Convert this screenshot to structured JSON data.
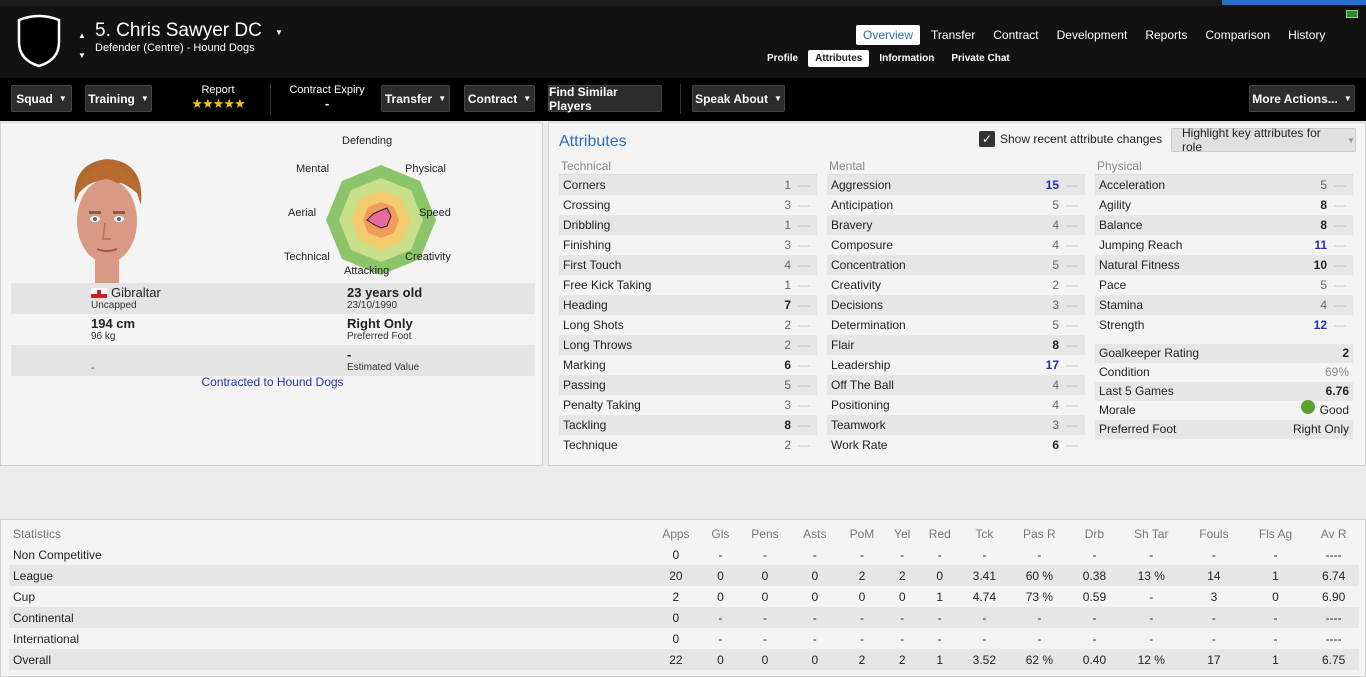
{
  "header": {
    "player_name": "5. Chris Sawyer DC",
    "subtitle": "Defender (Centre) - Hound Dogs",
    "main_tabs": [
      "Overview",
      "Transfer",
      "Contract",
      "Development",
      "Reports",
      "Comparison",
      "History"
    ],
    "active_main_tab": "Overview",
    "sub_tabs": [
      "Profile",
      "Attributes",
      "Information",
      "Private Chat"
    ],
    "active_sub_tab": "Attributes"
  },
  "toolbar": {
    "squad": "Squad",
    "training": "Training",
    "report_label": "Report",
    "report_stars": "★★★★★",
    "contract_expiry_label": "Contract Expiry",
    "contract_expiry_value": "-",
    "transfer": "Transfer",
    "contract": "Contract",
    "find_similar": "Find Similar Players",
    "speak_about": "Speak About",
    "more_actions": "More Actions..."
  },
  "profile": {
    "radar_labels": {
      "defending": "Defending",
      "physical": "Physical",
      "speed": "Speed",
      "creativity": "Creativity",
      "attacking": "Attacking",
      "technical": "Technical",
      "aerial": "Aerial",
      "mental": "Mental"
    },
    "nationality": "Gibraltar",
    "caps": "Uncapped",
    "age": "23 years old",
    "dob": "23/10/1990",
    "height": "194 cm",
    "weight": "96 kg",
    "foot": "Right Only",
    "foot_label": "Preferred Foot",
    "value": "-",
    "value_label": "Estimated Value",
    "wage": "-",
    "contracted": "Contracted to Hound Dogs"
  },
  "attributes": {
    "title": "Attributes",
    "show_changes_label": "Show recent attribute changes",
    "highlight_label": "Highlight key attributes for role",
    "technical": {
      "header": "Technical",
      "items": [
        {
          "name": "Corners",
          "value": "1"
        },
        {
          "name": "Crossing",
          "value": "3"
        },
        {
          "name": "Dribbling",
          "value": "1"
        },
        {
          "name": "Finishing",
          "value": "3"
        },
        {
          "name": "First Touch",
          "value": "4"
        },
        {
          "name": "Free Kick Taking",
          "value": "1"
        },
        {
          "name": "Heading",
          "value": "7"
        },
        {
          "name": "Long Shots",
          "value": "2"
        },
        {
          "name": "Long Throws",
          "value": "2"
        },
        {
          "name": "Marking",
          "value": "6"
        },
        {
          "name": "Passing",
          "value": "5"
        },
        {
          "name": "Penalty Taking",
          "value": "3"
        },
        {
          "name": "Tackling",
          "value": "8"
        },
        {
          "name": "Technique",
          "value": "2"
        }
      ]
    },
    "mental": {
      "header": "Mental",
      "items": [
        {
          "name": "Aggression",
          "value": "15"
        },
        {
          "name": "Anticipation",
          "value": "5"
        },
        {
          "name": "Bravery",
          "value": "4"
        },
        {
          "name": "Composure",
          "value": "4"
        },
        {
          "name": "Concentration",
          "value": "5"
        },
        {
          "name": "Creativity",
          "value": "2"
        },
        {
          "name": "Decisions",
          "value": "3"
        },
        {
          "name": "Determination",
          "value": "5"
        },
        {
          "name": "Flair",
          "value": "8"
        },
        {
          "name": "Leadership",
          "value": "17"
        },
        {
          "name": "Off The Ball",
          "value": "4"
        },
        {
          "name": "Positioning",
          "value": "4"
        },
        {
          "name": "Teamwork",
          "value": "3"
        },
        {
          "name": "Work Rate",
          "value": "6"
        }
      ]
    },
    "physical": {
      "header": "Physical",
      "items": [
        {
          "name": "Acceleration",
          "value": "5"
        },
        {
          "name": "Agility",
          "value": "8"
        },
        {
          "name": "Balance",
          "value": "8"
        },
        {
          "name": "Jumping Reach",
          "value": "11"
        },
        {
          "name": "Natural Fitness",
          "value": "10"
        },
        {
          "name": "Pace",
          "value": "5"
        },
        {
          "name": "Stamina",
          "value": "4"
        },
        {
          "name": "Strength",
          "value": "12"
        }
      ]
    },
    "summary": [
      {
        "name": "Goalkeeper Rating",
        "value": "2"
      },
      {
        "name": "Condition",
        "value": "69%"
      },
      {
        "name": "Last 5 Games",
        "value": "6.76"
      },
      {
        "name": "Morale",
        "value": "Good"
      },
      {
        "name": "Preferred Foot",
        "value": "Right Only"
      }
    ]
  },
  "statistics": {
    "headers": [
      "Statistics",
      "Apps",
      "Gls",
      "Pens",
      "Asts",
      "PoM",
      "Yel",
      "Red",
      "Tck",
      "Pas R",
      "Drb",
      "Sh Tar",
      "Fouls",
      "Fls Ag",
      "Av R"
    ],
    "rows": [
      [
        "Non Competitive",
        "0",
        "-",
        "-",
        "-",
        "-",
        "-",
        "-",
        "-",
        "-",
        "-",
        "-",
        "-",
        "-",
        "----"
      ],
      [
        "League",
        "20",
        "0",
        "0",
        "0",
        "2",
        "2",
        "0",
        "3.41",
        "60 %",
        "0.38",
        "13 %",
        "14",
        "1",
        "6.74"
      ],
      [
        "Cup",
        "2",
        "0",
        "0",
        "0",
        "0",
        "0",
        "1",
        "4.74",
        "73 %",
        "0.59",
        "-",
        "3",
        "0",
        "6.90"
      ],
      [
        "Continental",
        "0",
        "-",
        "-",
        "-",
        "-",
        "-",
        "-",
        "-",
        "-",
        "-",
        "-",
        "-",
        "-",
        "----"
      ],
      [
        "International",
        "0",
        "-",
        "-",
        "-",
        "-",
        "-",
        "-",
        "-",
        "-",
        "-",
        "-",
        "-",
        "-",
        "----"
      ],
      [
        "Overall",
        "22",
        "0",
        "0",
        "0",
        "2",
        "2",
        "1",
        "3.52",
        "62 %",
        "0.40",
        "12 %",
        "17",
        "1",
        "6.75"
      ]
    ]
  },
  "colors": {
    "accent": "#2f6eb3",
    "header_bg": "#121212",
    "stars": "#f0c020",
    "top_value": "#2233aa"
  }
}
